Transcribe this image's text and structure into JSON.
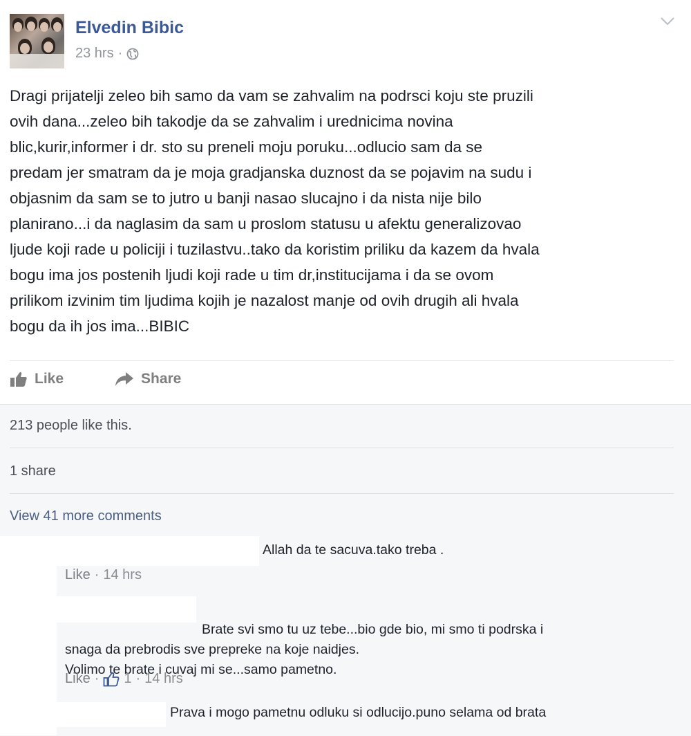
{
  "post": {
    "author": "Elvedin Bibic",
    "time": "23 hrs",
    "separator": "·",
    "privacy_icon": "globe-icon",
    "body": "Dragi prijatelji zeleo bih samo da vam se zahvalim na podrsci koju ste pruzili\novih dana...zeleo bih takodje da se zahvalim i urednicima novina\nblic,kurir,informer i dr. sto su preneli moju poruku...odlucio sam da se\npredam jer smatram da je moja gradjanska duznost da se pojavim na sudu i\nobjasnim da sam se to jutro u banji nasao slucajno i da nista nije bilo\nplanirano...i da naglasim da sam u proslom statusu u afektu generalizovao\nljude koji rade u policiji i tuzilastvu..tako da koristim priliku da kazem da hvala\nbogu ima jos postenih ljudi koji rade u tim dr,institucijama i da se ovom\nprilikom izvinim tim ljudima kojih je nazalost manje od ovih drugih ali hvala\nbogu da ih jos ima...BIBIC",
    "actions": {
      "like": "Like",
      "share": "Share"
    }
  },
  "stats": {
    "likes": "213 people like this.",
    "shares": "1 share"
  },
  "comments_section": {
    "view_more": "View 41 more comments",
    "comments": [
      {
        "text": "Allah da te sacuva.tako treba .",
        "like_label": "Like",
        "time": "14 hrs"
      },
      {
        "text": "Brate svi smo tu uz tebe...bio gde bio, mi smo ti podrska i\nsnaga da prebrodis sve prepreke na koje naidjes.\nVolimo te brate i cuvaj mi se...samo pametno.",
        "like_label": "Like",
        "like_count": "1",
        "time": "14 hrs"
      },
      {
        "text": "Prava i mogo pametnu odluku si odlucijo.puno selama od brata"
      }
    ]
  },
  "colors": {
    "author_link": "#3b5998",
    "meta_gray": "#90949c",
    "footer_bg": "#f6f7f9"
  }
}
